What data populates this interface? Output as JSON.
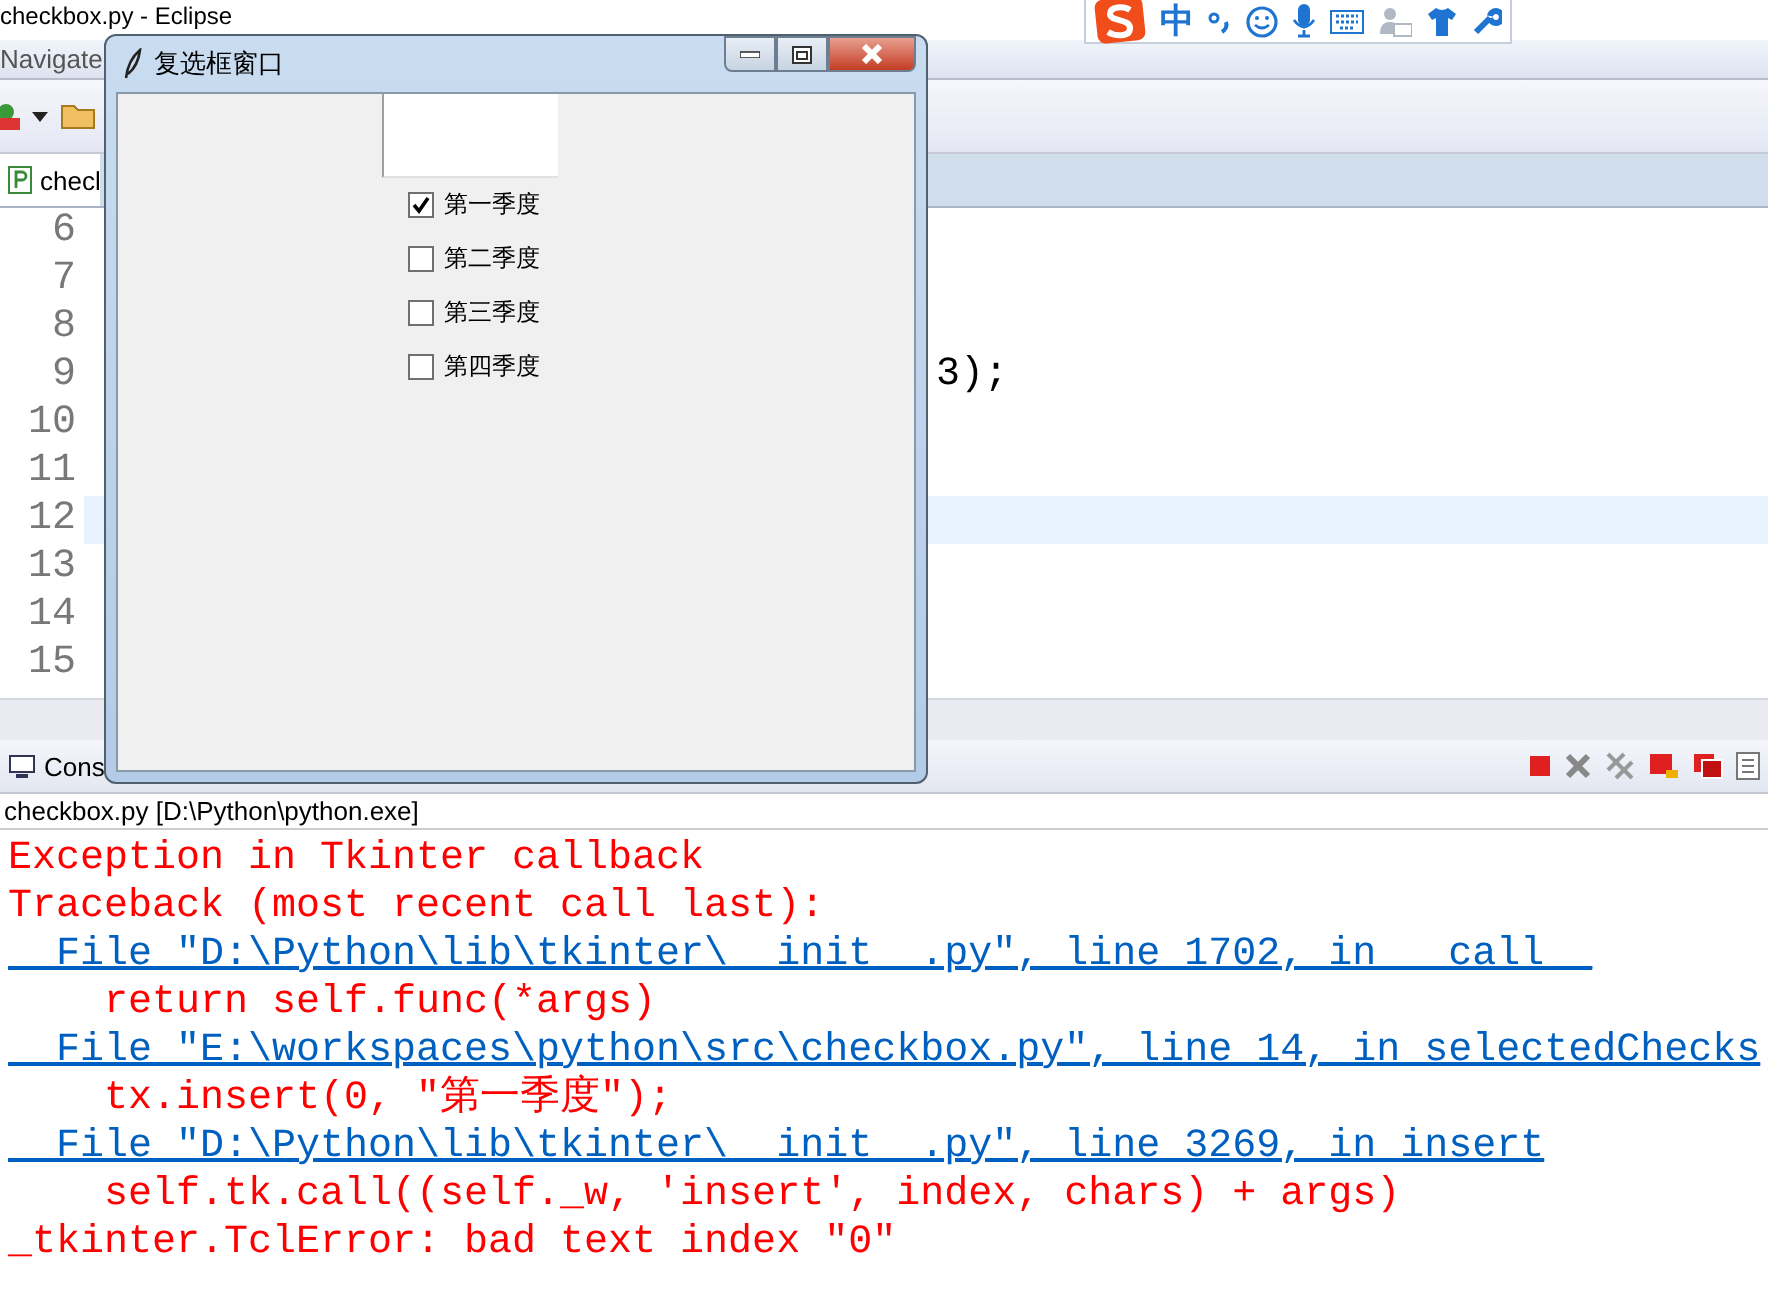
{
  "eclipse": {
    "title": "checkbox.py - Eclipse",
    "menu": [
      "Navigate"
    ],
    "editor_tab": "checl",
    "line_numbers": [
      "6",
      "7",
      "8",
      "9",
      "10",
      "11",
      "12",
      "13",
      "14",
      "15"
    ],
    "code_fragment": "3);",
    "console_tab": "Cons",
    "console_title": "checkbox.py [D:\\Python\\python.exe]",
    "output": [
      {
        "kind": "error",
        "text": "Exception in Tkinter callback"
      },
      {
        "kind": "error",
        "text": "Traceback (most recent call last):"
      },
      {
        "kind": "link",
        "text": "  File \"D:\\Python\\lib\\tkinter\\__init__.py\", line 1702, in __call__"
      },
      {
        "kind": "error",
        "text": "    return self.func(*args)"
      },
      {
        "kind": "link",
        "text": "  File \"E:\\workspaces\\python\\src\\checkbox.py\", line 14, in selectedChecks"
      },
      {
        "kind": "error",
        "text": "    tx.insert(0, \"第一季度\");"
      },
      {
        "kind": "link",
        "text": "  File \"D:\\Python\\lib\\tkinter\\__init__.py\", line 3269, in insert"
      },
      {
        "kind": "error",
        "text": "    self.tk.call((self._w, 'insert', index, chars) + args)"
      },
      {
        "kind": "error",
        "text": "_tkinter.TclError: bad text index \"0\""
      }
    ]
  },
  "ime": {
    "mode": "中"
  },
  "tk_window": {
    "title": "复选框窗口",
    "checkboxes": [
      {
        "label": "第一季度",
        "checked": true
      },
      {
        "label": "第二季度",
        "checked": false
      },
      {
        "label": "第三季度",
        "checked": false
      },
      {
        "label": "第四季度",
        "checked": false
      }
    ]
  }
}
